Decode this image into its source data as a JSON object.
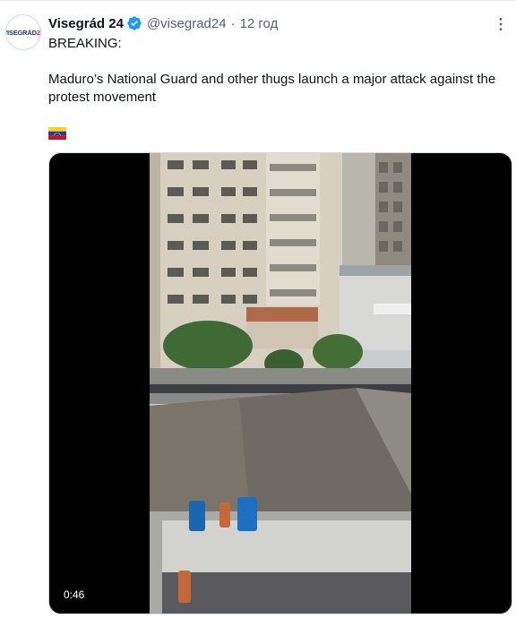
{
  "tweet": {
    "avatar": {
      "text_main": "VISEGRÁD",
      "text_num": "24"
    },
    "author_name": "Visegrád 24",
    "handle": "@visegrad24",
    "separator": "·",
    "time": "12 год",
    "text_line1": "BREAKING:",
    "text_line2": "Maduro’s National Guard and other thugs launch a major attack against the protest movement",
    "flag_emoji": "venezuela-flag",
    "verified_icon": "verified-badge-icon",
    "more_icon": "more-options-icon"
  },
  "media": {
    "duration": "0:46"
  },
  "colors": {
    "text": "#0f1419",
    "secondary": "#536471",
    "verified": "#1d9bf0",
    "flag_yellow": "#fcd116",
    "flag_blue": "#1f3f9e",
    "flag_red": "#ce1126"
  }
}
